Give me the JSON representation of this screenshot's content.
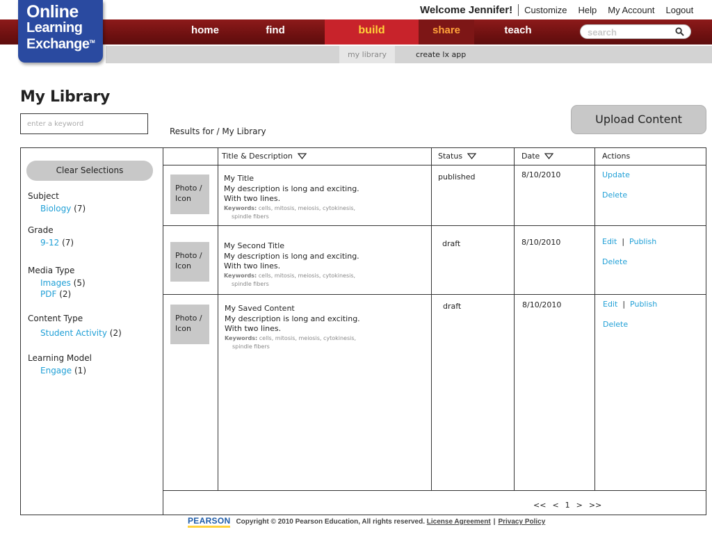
{
  "logo": {
    "line1": "Online",
    "line2": "Learning",
    "line3": "Exchange",
    "tm": "TM"
  },
  "header": {
    "welcome": "Welcome Jennifer!",
    "links": [
      "Customize",
      "Help",
      "My Account",
      "Logout"
    ]
  },
  "nav": {
    "items": [
      "home",
      "find",
      "build",
      "share",
      "teach"
    ],
    "active": "build",
    "search_placeholder": "search"
  },
  "subnav": {
    "items": [
      "my library",
      "create lx app"
    ],
    "active": "my library"
  },
  "page": {
    "title": "My Library",
    "keyword_placeholder": "enter a keyword",
    "results_for": "Results for / My Library",
    "upload_label": "Upload Content"
  },
  "sidebar": {
    "clear_label": "Clear Selections",
    "facets": [
      {
        "title": "Subject",
        "value": "Biology",
        "count": "(7)"
      },
      {
        "title": "Grade",
        "value": "9-12",
        "count": "(7)"
      },
      {
        "title": "Media Type",
        "values": [
          {
            "value": "Images",
            "count": "(5)"
          },
          {
            "value": "PDF",
            "count": "(2)"
          }
        ]
      },
      {
        "title": "Content Type",
        "value": "Student Activity",
        "count": "(2)"
      },
      {
        "title": "Learning Model",
        "value": "Engage",
        "count": "(1)"
      }
    ]
  },
  "table": {
    "headers": [
      "Title & Description",
      "Status",
      "Date",
      "Actions"
    ],
    "rows": [
      {
        "photo": [
          "Photo /",
          "Icon"
        ],
        "title": "My Title",
        "desc1": "My description is long and exciting.",
        "desc2": "With two lines.",
        "kw_label": "Keywords:",
        "kw1": " cells, mitosis, meiosis, cytokinesis,",
        "kw2": "spindle fibers",
        "status": "published",
        "date": "8/10/2010",
        "actions": [
          "Update",
          "Delete"
        ]
      },
      {
        "photo": [
          "Photo /",
          "Icon"
        ],
        "title": "My Second Title",
        "desc1": "My description is long and exciting.",
        "desc2": "With two lines.",
        "kw_label": "Keywords:",
        "kw1": " cells, mitosis, meiosis, cytokinesis,",
        "kw2": "spindle fibers",
        "status": "draft",
        "date": "8/10/2010",
        "actions": [
          "Edit",
          "|",
          "Publish",
          "Delete"
        ]
      },
      {
        "photo": [
          "Photo /",
          "Icon"
        ],
        "title": "My Saved Content",
        "desc1": "My description is long and exciting.",
        "desc2": "With two lines.",
        "kw_label": "Keywords:",
        "kw1": " cells, mitosis, meiosis, cytokinesis,",
        "kw2": "spindle fibers",
        "status": "draft",
        "date": "8/10/2010",
        "actions": [
          "Edit",
          "|",
          "Publish",
          "Delete"
        ]
      }
    ],
    "pager": [
      "<<",
      "<",
      "1",
      ">",
      ">>"
    ]
  },
  "footer": {
    "brand": "PEARSON",
    "copyright": "Copyright © 2010 Pearson Education, All rights reserved.",
    "license": "License Agreement",
    "separator": "|",
    "privacy": "Privacy Policy"
  },
  "colors": {
    "nav_red": "#7a1414",
    "active_tab": "#c8232b",
    "build_text": "#ffd23a",
    "share_text": "#ffa23a",
    "link_blue": "#1f9fd6",
    "logo_blue": "#2a4aa0"
  }
}
